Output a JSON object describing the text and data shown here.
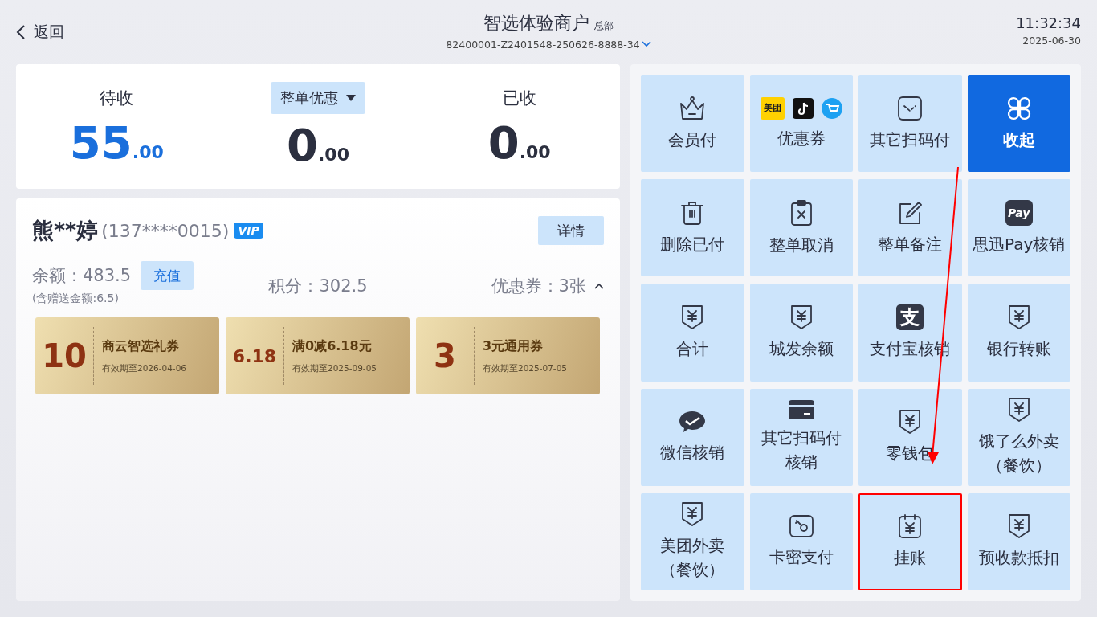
{
  "header": {
    "back": "返回",
    "merchant": "智选体验商户",
    "merchant_tag": "总部",
    "order_no": "82400001-Z2401548-250626-8888-34",
    "time": "11:32:34",
    "date": "2025-06-30"
  },
  "summary": [
    {
      "kind": "label",
      "label": "待收",
      "amount": "55",
      "decimals": ".00",
      "accent": true
    },
    {
      "kind": "dropdown",
      "label": "整单优惠",
      "amount": "0",
      "decimals": ".00",
      "accent": false
    },
    {
      "kind": "label",
      "label": "已收",
      "amount": "0",
      "decimals": ".00",
      "accent": false
    }
  ],
  "member": {
    "name": "熊**婷",
    "phone": "(137****0015)",
    "badge": "VIP",
    "details_button": "详情",
    "balance": "余额：483.5",
    "recharge_button": "充值",
    "bonus_note": "(含赠送金额:6.5)",
    "points": "积分：302.5",
    "coupons_label": "优惠券：3张",
    "coupons_expanded": true,
    "coupons": [
      {
        "value": "10",
        "title": "商云智选礼券",
        "expiry": "有效期至2026-04-06"
      },
      {
        "value": "6.18",
        "title": "满0减6.18元",
        "expiry": "有效期至2025-09-05"
      },
      {
        "value": "3",
        "title": "3元通用券",
        "expiry": "有效期至2025-07-05"
      }
    ]
  },
  "tiles": [
    {
      "kind": "crown",
      "lines": [
        "会员付"
      ],
      "selected": false,
      "highlighted": false
    },
    {
      "kind": "brands",
      "icon_text": "美团",
      "lines": [
        "优惠券"
      ],
      "selected": false,
      "highlighted": false
    },
    {
      "kind": "scan",
      "lines": [
        "其它扫码付"
      ],
      "selected": false,
      "highlighted": false
    },
    {
      "kind": "grid",
      "lines": [
        "收起"
      ],
      "selected": true,
      "highlighted": false
    },
    {
      "kind": "trash",
      "lines": [
        "删除已付"
      ],
      "selected": false,
      "highlighted": false
    },
    {
      "kind": "clipboard",
      "lines": [
        "整单取消"
      ],
      "selected": false,
      "highlighted": false
    },
    {
      "kind": "edit",
      "lines": [
        "整单备注"
      ],
      "selected": false,
      "highlighted": false
    },
    {
      "kind": "pay",
      "icon_text": "Pay",
      "lines": [
        "思迅Pay核销"
      ],
      "selected": false,
      "highlighted": false
    },
    {
      "kind": "yen",
      "lines": [
        "合计"
      ],
      "selected": false,
      "highlighted": false
    },
    {
      "kind": "yen",
      "lines": [
        "城发余额"
      ],
      "selected": false,
      "highlighted": false
    },
    {
      "kind": "alipay",
      "icon_text": "支",
      "lines": [
        "支付宝核销"
      ],
      "selected": false,
      "highlighted": false
    },
    {
      "kind": "yen",
      "lines": [
        "银行转账"
      ],
      "selected": false,
      "highlighted": false
    },
    {
      "kind": "wechat",
      "lines": [
        "微信核销"
      ],
      "selected": false,
      "highlighted": false
    },
    {
      "kind": "card",
      "lines": [
        "其它扫码付",
        "核销"
      ],
      "selected": false,
      "highlighted": false
    },
    {
      "kind": "yen",
      "lines": [
        "零钱包"
      ],
      "selected": false,
      "highlighted": false
    },
    {
      "kind": "yen",
      "lines": [
        "饿了么外卖",
        "（餐饮）"
      ],
      "selected": false,
      "highlighted": false
    },
    {
      "kind": "yen",
      "lines": [
        "美团外卖",
        "（餐饮）"
      ],
      "selected": false,
      "highlighted": false
    },
    {
      "kind": "key",
      "lines": [
        "卡密支付"
      ],
      "selected": false,
      "highlighted": false
    },
    {
      "kind": "calendar",
      "lines": [
        "挂账"
      ],
      "selected": false,
      "highlighted": true
    },
    {
      "kind": "yen",
      "lines": [
        "预收款抵扣"
      ],
      "selected": false,
      "highlighted": false
    }
  ]
}
